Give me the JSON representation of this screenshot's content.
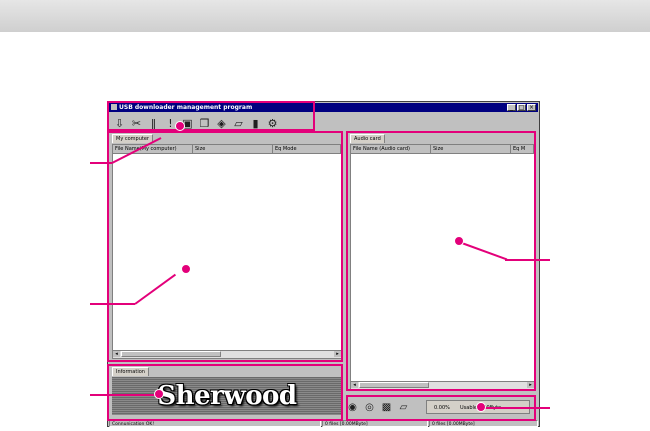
{
  "window": {
    "title": "USB downloader management program",
    "controls": [
      "_",
      "□",
      "×"
    ]
  },
  "toolbar": {
    "icons": [
      "transfer-icon",
      "cut-icon",
      "pause-icon",
      "stop-icon",
      "save-icon",
      "copy-icon",
      "disk-icon",
      "eraser-icon",
      "card-icon",
      "settings-icon"
    ]
  },
  "my_computer": {
    "tab": "My computer",
    "columns": [
      "File Name(My computer)",
      "Size",
      "Eq Mode"
    ]
  },
  "audio_card": {
    "tab": "Audio card",
    "columns": [
      "File Name (Audio card)",
      "Size",
      "Eq M"
    ]
  },
  "information": {
    "tab": "Information",
    "logo_text": "Sherwood"
  },
  "status_bar": {
    "connection": "Connunication OK!",
    "left_files": "0 files [0.00MByte]",
    "right_files": "0 files [0.00MByte]"
  },
  "progress": {
    "percent": "0.00%",
    "usage": "Usable 0.00Byte"
  },
  "colors": {
    "accent": "#e3007a",
    "titlebar": "#000080"
  }
}
